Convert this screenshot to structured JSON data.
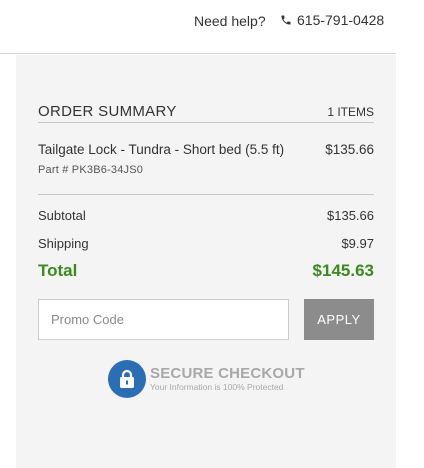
{
  "header": {
    "help_text": "Need help?",
    "phone_icon": "phone-icon",
    "phone": "615-791-0428"
  },
  "summary": {
    "title": "ORDER SUMMARY",
    "item_count": "1 ITEMS",
    "items": [
      {
        "name": "Tailgate Lock - Tundra - Short bed (5.5 ft)",
        "price": "$135.66",
        "part": "Part # PK3B6-34JS0"
      }
    ],
    "subtotal_label": "Subtotal",
    "subtotal_value": "$135.66",
    "shipping_label": "Shipping",
    "shipping_value": "$9.97",
    "total_label": "Total",
    "total_value": "$145.63"
  },
  "promo": {
    "placeholder": "Promo Code",
    "value": "",
    "apply_label": "APPLY"
  },
  "secure": {
    "icon": "lock-icon",
    "title": "SECURE CHECKOUT",
    "subtitle": "Your Information is 100% Protected"
  },
  "colors": {
    "total_green": "#3a8a1f",
    "lock_blue": "#2a6fb5",
    "apply_gray": "#8c8c8c",
    "panel_bg": "#f4f4f4"
  }
}
